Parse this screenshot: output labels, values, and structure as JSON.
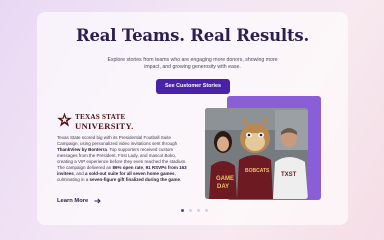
{
  "hero": {
    "headline": "Real Teams. Real Results.",
    "subtext": "Explore stories from teams who are engaging more donors, showing more impact, and growing generosity with ease.",
    "cta_label": "See Customer Stories"
  },
  "story": {
    "logo_line1": "TEXAS STATE",
    "logo_line2": "UNIVERSITY.",
    "body_intro": "Texas State scored big with its Presidential Football Suite Campaign, using personalized video invitations sent through ",
    "body_brand": "ThankView by Bonterra",
    "body_middle1": ". Top supporters received custom messages from the President, First Lady, and mascot Boko, creating a VIP experience before they even reached the stadium. The campaign delivered an ",
    "body_stat1": "86% open rate",
    "body_sep1": ", ",
    "body_stat2": "91 RSVPs from 163 invitees",
    "body_middle2": ", and ",
    "body_stat3": "a sold-out suite for all seven home games",
    "body_middle3": ", culminating in a ",
    "body_stat4": "seven-figure gift finalized during the game",
    "body_end": ".",
    "learn_more": "Learn More"
  },
  "carousel": {
    "slide_count": 4,
    "active_index": 0
  },
  "colors": {
    "accent": "#4a22a8",
    "heading": "#2a1f4f",
    "maroon": "#501214",
    "photo_frame": "#8a5ed6"
  }
}
